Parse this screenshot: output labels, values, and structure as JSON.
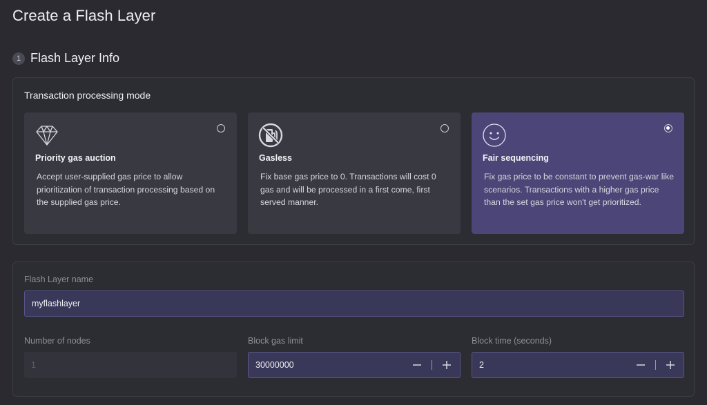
{
  "page": {
    "title": "Create a Flash Layer"
  },
  "step": {
    "number": "1",
    "title": "Flash Layer Info"
  },
  "processing_mode": {
    "label": "Transaction processing mode",
    "selected": "fair-sequencing",
    "options": [
      {
        "id": "priority-gas-auction",
        "icon": "diamond-icon",
        "title": "Priority gas auction",
        "description": "Accept user-supplied gas price to allow prioritization of transaction processing based on the supplied gas price."
      },
      {
        "id": "gasless",
        "icon": "no-fuel-icon",
        "title": "Gasless",
        "description": "Fix base gas price to 0. Transactions will cost 0 gas and will be processed in a first come, first served manner."
      },
      {
        "id": "fair-sequencing",
        "icon": "smiley-icon",
        "title": "Fair sequencing",
        "description": "Fix gas price to be constant to prevent gas-war like scenarios. Transactions with a higher gas price than the set gas price won't get prioritized."
      }
    ]
  },
  "form": {
    "name": {
      "label": "Flash Layer name",
      "value": "myflashlayer"
    },
    "nodes": {
      "label": "Number of nodes",
      "value": "1",
      "disabled": true
    },
    "gas_limit": {
      "label": "Block gas limit",
      "value": "30000000"
    },
    "block_time": {
      "label": "Block time (seconds)",
      "value": "2"
    }
  },
  "colors": {
    "background": "#2a2a30",
    "card": "#393942",
    "card_selected": "#4b4677",
    "input_bg": "#3a3859"
  }
}
